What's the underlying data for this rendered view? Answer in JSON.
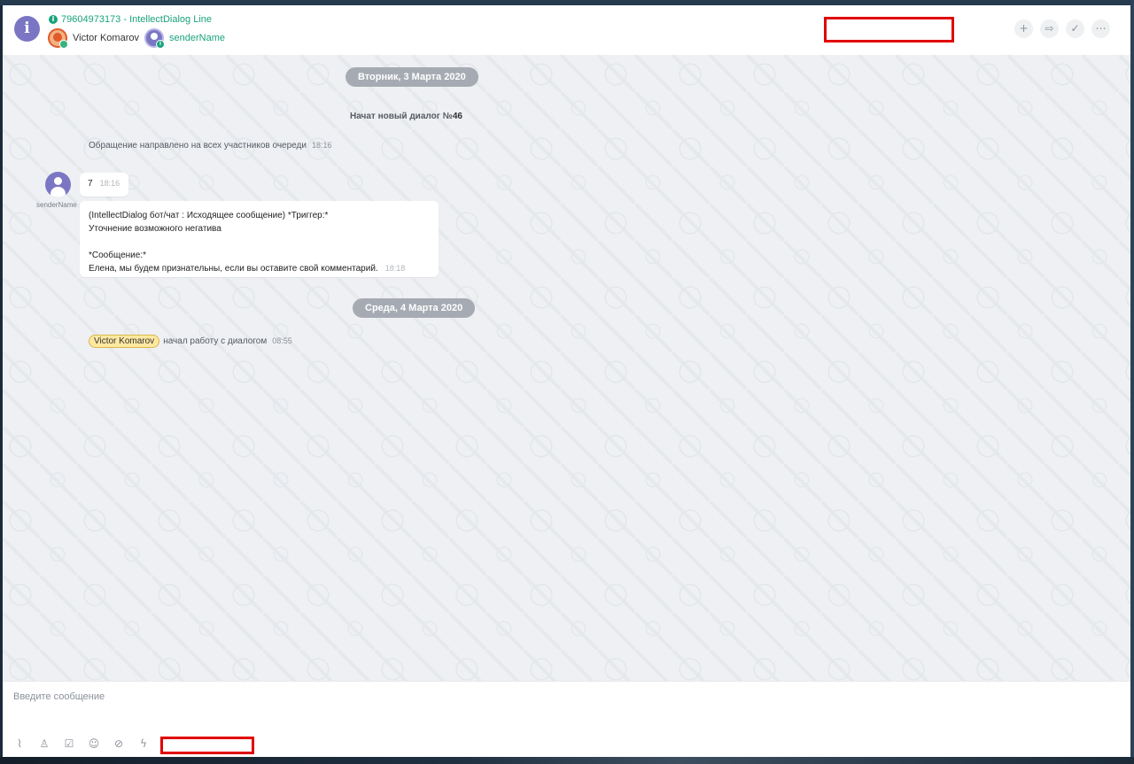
{
  "header": {
    "line_title": "79604973173 - IntellectDialog Line",
    "operator_name": "Victor Komarov",
    "client_name": "senderName",
    "actions": [
      {
        "icon": "plus-icon",
        "glyph": "+"
      },
      {
        "icon": "transfer-icon",
        "glyph": "⇨"
      },
      {
        "icon": "check-circle-icon",
        "glyph": "✓"
      },
      {
        "icon": "more-icon",
        "glyph": "⋯"
      }
    ]
  },
  "chat": {
    "date1": "Вторник, 3 Марта 2020",
    "new_dialog_text": "Начат новый диалог №",
    "new_dialog_number": "46",
    "queue_notice": "Обращение направлено на всех участников очереди",
    "queue_notice_time": "18:16",
    "sender_label": "senderName",
    "message1": {
      "text": "7",
      "time": "18:16"
    },
    "message2": {
      "line1": "(IntellectDialog бот/чат : Исходящее сообщение) *Триггер:*",
      "line2": "Уточнение возможного негатива",
      "line3": "*Сообщение:*",
      "line4": "Елена, мы будем признательны, если вы оставите свой комментарий.",
      "time": "18:18"
    },
    "date2": "Среда, 4 Марта 2020",
    "operator_tag": "Victor Komarov",
    "operator_action": "начал работу с диалогом",
    "operator_action_time": "08:55"
  },
  "composer": {
    "placeholder": "Введите сообщение",
    "tools": [
      {
        "icon": "paperclip-icon",
        "glyph": "⌇"
      },
      {
        "icon": "user-icon",
        "glyph": "♙"
      },
      {
        "icon": "checkbox-icon",
        "glyph": "☑"
      },
      {
        "icon": "smile-icon",
        "glyph": "☺"
      },
      {
        "icon": "eye-off-icon",
        "glyph": "⊘"
      },
      {
        "icon": "lightning-icon",
        "glyph": "ϟ"
      }
    ]
  },
  "colors": {
    "accent": "#1aa37c",
    "avatar": "#7b76c4",
    "redaction": "#e10000",
    "date_pill": "#a6abb3"
  }
}
